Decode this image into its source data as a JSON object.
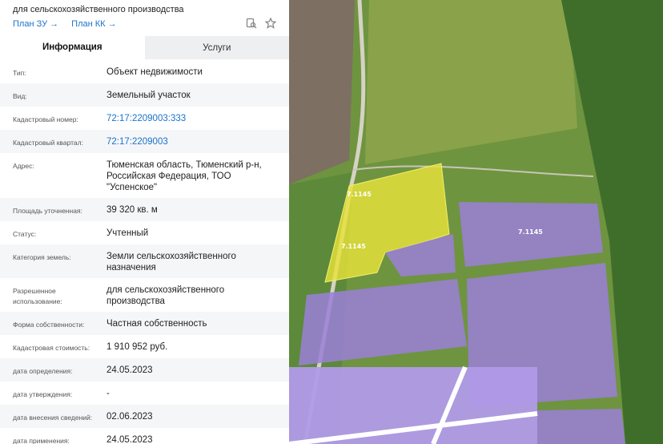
{
  "panel": {
    "title": "для сельскохозяйственного производства",
    "links": {
      "plan_zu": "План ЗУ",
      "plan_kk": "План КК"
    },
    "tabs": {
      "info": "Информация",
      "services": "Услуги"
    },
    "rows": [
      {
        "label": "Тип:",
        "value": "Объект недвижимости"
      },
      {
        "label": "Вид:",
        "value": "Земельный участок"
      },
      {
        "label": "Кадастровый номер:",
        "value": "72:17:2209003:333"
      },
      {
        "label": "Кадастровый квартал:",
        "value": "72:17:2209003"
      },
      {
        "label": "Адрес:",
        "value": "Тюменская область, Тюменский р-н, Российская Федерация, ТОО \"Успенское\""
      },
      {
        "label": "Площадь уточненная:",
        "value": "39 320 кв. м"
      },
      {
        "label": "Статус:",
        "value": "Учтенный"
      },
      {
        "label": "Категория земель:",
        "value": "Земли сельскохозяйственного назначения"
      },
      {
        "label": "Разрешенное использование:",
        "value": "для сельскохозяйственного производства"
      },
      {
        "label": "Форма собственности:",
        "value": "Частная собственность"
      },
      {
        "label": "Кадастровая стоимость:",
        "value": "1 910 952 руб."
      },
      {
        "label": "дата определения:",
        "value": "24.05.2023"
      },
      {
        "label": "дата утверждения:",
        "value": "-"
      },
      {
        "label": "дата внесения сведений:",
        "value": "02.06.2023"
      },
      {
        "label": "дата применения:",
        "value": "24.05.2023"
      }
    ]
  },
  "map": {
    "parcel_labels": {
      "yellow_top": "7.1145",
      "yellow_bottom": "7.1145",
      "purple_right": "7.1145"
    },
    "colors": {
      "selected_parcel": "#e8e23a",
      "other_parcel": "#9b7fd8",
      "field": "#6a8f3e",
      "road": "#d9d9cf"
    }
  }
}
